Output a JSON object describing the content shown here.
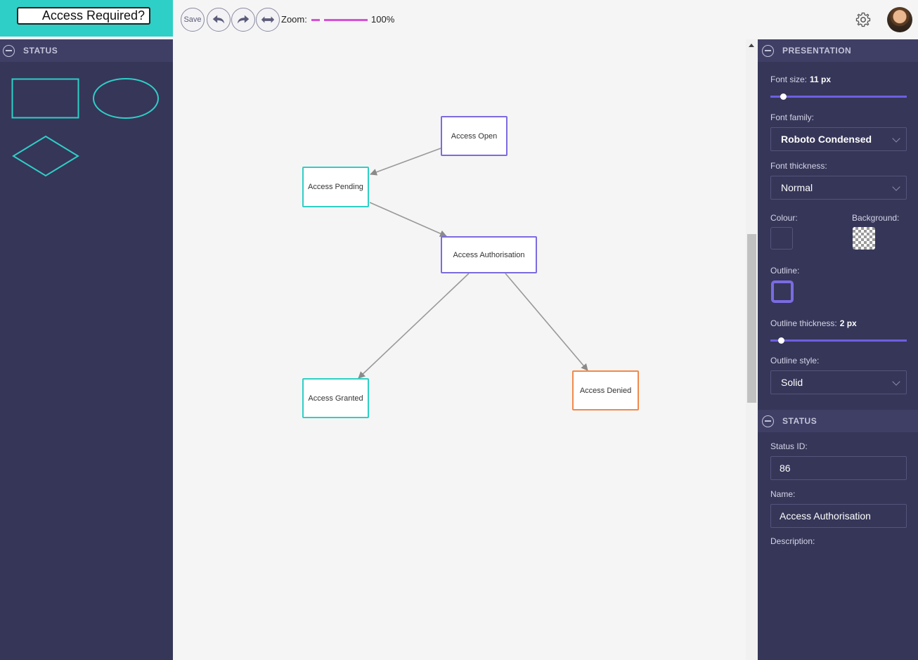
{
  "header": {
    "title": "Access Required?"
  },
  "toolbar": {
    "save_label": "Save",
    "zoom_label": "Zoom:",
    "zoom_value": "100%",
    "zoom_level": 1.0
  },
  "palette": {
    "section_title": "STATUS",
    "shapes": [
      "rectangle",
      "ellipse",
      "diamond"
    ],
    "accent": "#2ecfc6"
  },
  "diagram": {
    "nodes": [
      {
        "id": "open",
        "label": "Access Open",
        "color": "#7b6be0"
      },
      {
        "id": "pending",
        "label": "Access Pending",
        "color": "#2ecfc6"
      },
      {
        "id": "auth",
        "label": "Access Authorisation",
        "color": "#7b6be0"
      },
      {
        "id": "granted",
        "label": "Access Granted",
        "color": "#2ecfc6"
      },
      {
        "id": "denied",
        "label": "Access Denied",
        "color": "#f08a4b"
      }
    ],
    "edges": [
      {
        "from": "open",
        "to": "pending"
      },
      {
        "from": "pending",
        "to": "auth"
      },
      {
        "from": "auth",
        "to": "granted"
      },
      {
        "from": "auth",
        "to": "denied"
      }
    ]
  },
  "presentation": {
    "section_title": "PRESENTATION",
    "font_size_label": "Font size:",
    "font_size_value": "11 px",
    "font_family_label": "Font family:",
    "font_family_value": "Roboto Condensed",
    "font_thickness_label": "Font thickness:",
    "font_thickness_value": "Normal",
    "colour_label": "Colour:",
    "background_label": "Background:",
    "outline_label": "Outline:",
    "outline_color": "#7b6be0",
    "outline_thickness_label": "Outline thickness:",
    "outline_thickness_value": "2 px",
    "outline_style_label": "Outline style:",
    "outline_style_value": "Solid"
  },
  "status": {
    "section_title": "STATUS",
    "id_label": "Status ID:",
    "id_value": "86",
    "name_label": "Name:",
    "name_value": "Access Authorisation",
    "description_label": "Description:"
  }
}
